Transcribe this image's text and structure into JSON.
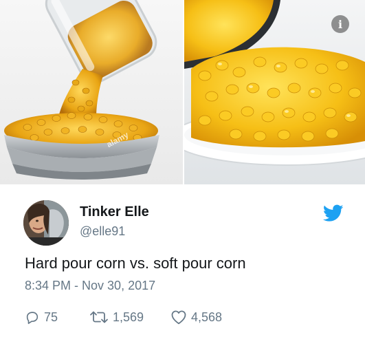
{
  "tweet": {
    "author_name": "Tinker Elle",
    "author_handle": "@elle91",
    "text": "Hard pour corn vs. soft pour corn",
    "timestamp": "8:34 PM - Nov 30, 2017",
    "reply_count": "75",
    "retweet_count": "1,569",
    "like_count": "4,568"
  },
  "images": {
    "watermark": "alamy",
    "info_glyph": "i"
  },
  "icons": {
    "brand": "twitter-bird-icon",
    "reply": "reply-icon",
    "retweet": "retweet-icon",
    "like": "heart-icon",
    "info": "info-icon"
  },
  "colors": {
    "name": "#14171a",
    "secondary": "#657786",
    "twitter_blue": "#1da1f2",
    "corn_yellow": "#f5c21b"
  }
}
